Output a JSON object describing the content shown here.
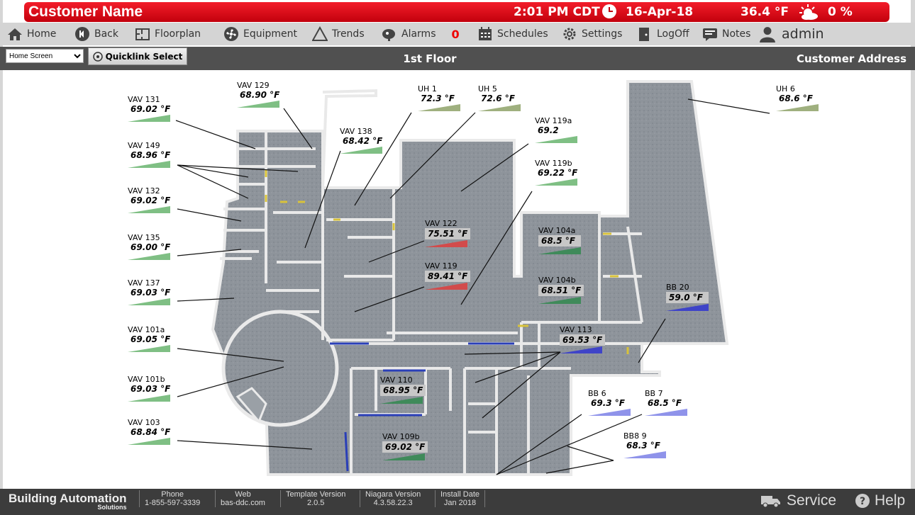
{
  "header": {
    "customer_name": "Customer Name",
    "time": "2:01 PM CDT",
    "date": "16-Apr-18",
    "outdoor_temp": "36.4 °F",
    "precip": "0 %"
  },
  "nav": {
    "home": "Home",
    "back": "Back",
    "floorplan": "Floorplan",
    "equipment": "Equipment",
    "trends": "Trends",
    "alarms": "Alarms",
    "alarm_count": "0",
    "schedules": "Schedules",
    "settings": "Settings",
    "logoff": "LogOff",
    "notes": "Notes",
    "user": "admin"
  },
  "subbar": {
    "screen_select": "Home Screen",
    "quicklink": "Quicklink Select",
    "floor_title": "1st Floor",
    "address": "Customer Address"
  },
  "units": [
    {
      "label": "VAV  131",
      "value": "69.02 °F"
    },
    {
      "label": "VAV  129",
      "value": "68.90 °F"
    },
    {
      "label": "VAV  149",
      "value": "68.96 °F"
    },
    {
      "label": "VAV  132",
      "value": "69.02 °F"
    },
    {
      "label": "VAV  135",
      "value": "69.00 °F"
    },
    {
      "label": "VAV  137",
      "value": "69.03 °F"
    },
    {
      "label": "VAV  101a",
      "value": "69.05 °F"
    },
    {
      "label": "VAV  101b",
      "value": "69.03 °F"
    },
    {
      "label": "VAV  103",
      "value": "68.84 °F"
    },
    {
      "label": "VAV  138",
      "value": "68.42 °F"
    },
    {
      "label": "UH  1",
      "value": "72.3 °F"
    },
    {
      "label": "UH  5",
      "value": "72.6 °F"
    },
    {
      "label": "VAV  119a",
      "value": "69.2"
    },
    {
      "label": "VAV  119b",
      "value": "69.22 °F"
    },
    {
      "label": "UH  6",
      "value": "68.6 °F"
    },
    {
      "label": "VAV  122",
      "value": "75.51 °F"
    },
    {
      "label": "VAV  119",
      "value": "89.41 °F"
    },
    {
      "label": "VAV  104a",
      "value": "68.5 °F"
    },
    {
      "label": "VAV  104b",
      "value": "68.51 °F"
    },
    {
      "label": "BB  20",
      "value": "59.0 °F"
    },
    {
      "label": "VAV  113",
      "value": "69.53 °F"
    },
    {
      "label": "VAV  110",
      "value": "68.95 °F"
    },
    {
      "label": "BB  6",
      "value": "69.3 °F"
    },
    {
      "label": "BB  7",
      "value": "68.5 °F"
    },
    {
      "label": "BB8  9",
      "value": "68.3 °F"
    },
    {
      "label": "VAV  109b",
      "value": "69.02 °F"
    }
  ],
  "colors": {
    "normal": "#7fbf84",
    "warm": "#d24b4b",
    "cool": "#3f44c8",
    "uh": "#9fb07f",
    "bb": "#8f93ea"
  },
  "footer": {
    "brand": "Building Automation",
    "brand_sub": "Solutions",
    "phone_label": "Phone",
    "phone": "1-855-597-3339",
    "web_label": "Web",
    "web": "bas-ddc.com",
    "template_label": "Template Version",
    "template": "2.0.5",
    "niagara_label": "Niagara Version",
    "niagara": "4.3.58.22.3",
    "install_label": "Install Date",
    "install": "Jan 2018",
    "service": "Service",
    "help": "Help"
  }
}
